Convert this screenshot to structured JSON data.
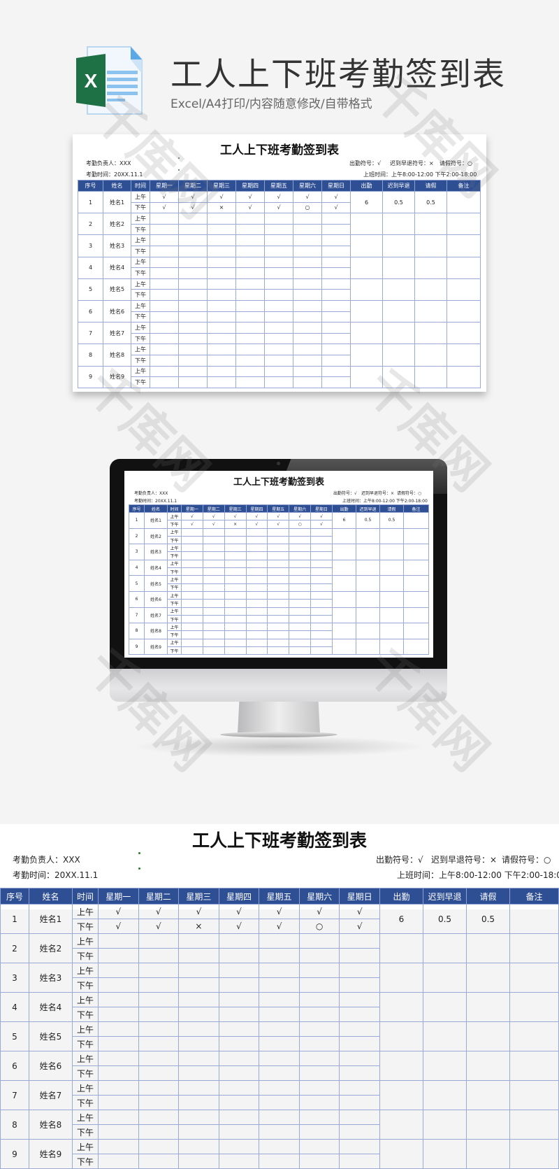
{
  "header": {
    "title": "工人上下班考勤签到表",
    "subtitle": "Excel/A4打印/内容随意修改/自带格式",
    "file_icon_letter": "X"
  },
  "sheet": {
    "title": "工人上下班考勤签到表",
    "manager_label": "考勤负责人：XXX",
    "date_label": "考勤时间：20XX.11.1",
    "legend": {
      "present": "出勤符号：√",
      "late": "迟到早退符号：×",
      "leave": "请假符号：○"
    },
    "work_hours": "上班时间：上午8:00-12:00  下午2:00-18:00",
    "columns": [
      "序号",
      "姓名",
      "时间",
      "星期一",
      "星期二",
      "星期三",
      "星期四",
      "星期五",
      "星期六",
      "星期日",
      "出勤",
      "迟到早退",
      "请假",
      "备注"
    ],
    "periods": [
      "上午",
      "下午"
    ],
    "rows": [
      {
        "no": "1",
        "name": "姓名1",
        "am": [
          "√",
          "√",
          "√",
          "√",
          "√",
          "√",
          "√"
        ],
        "pm": [
          "√",
          "√",
          "×",
          "√",
          "√",
          "○",
          "√"
        ],
        "present": "6",
        "late": "0.5",
        "leave": "0.5",
        "note": ""
      },
      {
        "no": "2",
        "name": "姓名2",
        "am": [
          "",
          "",
          "",
          "",
          "",
          "",
          ""
        ],
        "pm": [
          "",
          "",
          "",
          "",
          "",
          "",
          ""
        ],
        "present": "",
        "late": "",
        "leave": "",
        "note": ""
      },
      {
        "no": "3",
        "name": "姓名3",
        "am": [
          "",
          "",
          "",
          "",
          "",
          "",
          ""
        ],
        "pm": [
          "",
          "",
          "",
          "",
          "",
          "",
          ""
        ],
        "present": "",
        "late": "",
        "leave": "",
        "note": ""
      },
      {
        "no": "4",
        "name": "姓名4",
        "am": [
          "",
          "",
          "",
          "",
          "",
          "",
          ""
        ],
        "pm": [
          "",
          "",
          "",
          "",
          "",
          "",
          ""
        ],
        "present": "",
        "late": "",
        "leave": "",
        "note": ""
      },
      {
        "no": "5",
        "name": "姓名5",
        "am": [
          "",
          "",
          "",
          "",
          "",
          "",
          ""
        ],
        "pm": [
          "",
          "",
          "",
          "",
          "",
          "",
          ""
        ],
        "present": "",
        "late": "",
        "leave": "",
        "note": ""
      },
      {
        "no": "6",
        "name": "姓名6",
        "am": [
          "",
          "",
          "",
          "",
          "",
          "",
          ""
        ],
        "pm": [
          "",
          "",
          "",
          "",
          "",
          "",
          ""
        ],
        "present": "",
        "late": "",
        "leave": "",
        "note": ""
      },
      {
        "no": "7",
        "name": "姓名7",
        "am": [
          "",
          "",
          "",
          "",
          "",
          "",
          ""
        ],
        "pm": [
          "",
          "",
          "",
          "",
          "",
          "",
          ""
        ],
        "present": "",
        "late": "",
        "leave": "",
        "note": ""
      },
      {
        "no": "8",
        "name": "姓名8",
        "am": [
          "",
          "",
          "",
          "",
          "",
          "",
          ""
        ],
        "pm": [
          "",
          "",
          "",
          "",
          "",
          "",
          ""
        ],
        "present": "",
        "late": "",
        "leave": "",
        "note": ""
      },
      {
        "no": "9",
        "name": "姓名9",
        "am": [
          "",
          "",
          "",
          "",
          "",
          "",
          ""
        ],
        "pm": [
          "",
          "",
          "",
          "",
          "",
          "",
          ""
        ],
        "present": "",
        "late": "",
        "leave": "",
        "note": ""
      }
    ]
  },
  "colors": {
    "header_blue": "#2f4f94",
    "grid_blue": "#9aaad6",
    "excel_green": "#1e7145",
    "doc_blue": "#5aa9e6"
  }
}
